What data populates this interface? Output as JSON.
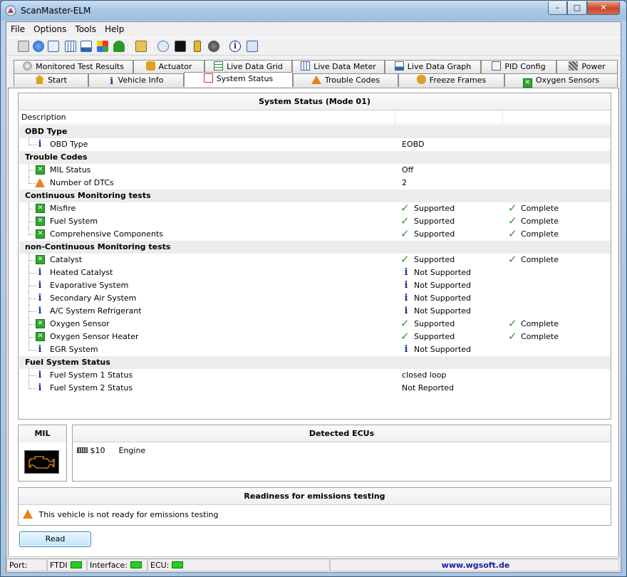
{
  "window": {
    "title": "ScanMaster-ELM",
    "controls": {
      "minimize": "–",
      "maximize": "□",
      "close": "✕"
    }
  },
  "menu": [
    "File",
    "Options",
    "Tools",
    "Help"
  ],
  "tabs_row1": [
    "Monitored Test Results",
    "Actuator",
    "Live Data Grid",
    "Live Data Meter",
    "Live Data Graph",
    "PID Config",
    "Power"
  ],
  "tabs_row2": [
    "Start",
    "Vehicle Info",
    "System Status",
    "Trouble Codes",
    "Freeze Frames",
    "Oxygen Sensors"
  ],
  "system_status": {
    "title": "System Status (Mode 01)",
    "column_description": "Description",
    "groups": [
      {
        "name": "OBD Type",
        "items": [
          {
            "label": "OBD Type",
            "icon": "info",
            "value1": "EOBD",
            "value2": ""
          }
        ]
      },
      {
        "name": "Trouble Codes",
        "items": [
          {
            "label": "MIL Status",
            "icon": "green",
            "value1": "Off",
            "value2": ""
          },
          {
            "label": "Number of DTCs",
            "icon": "warning",
            "value1": "2",
            "value2": ""
          }
        ]
      },
      {
        "name": "Continuous Monitoring tests",
        "items": [
          {
            "label": "Misfire",
            "icon": "green",
            "value1": "Supported",
            "value2": "Complete"
          },
          {
            "label": "Fuel System",
            "icon": "green",
            "value1": "Supported",
            "value2": "Complete"
          },
          {
            "label": "Comprehensive Components",
            "icon": "green",
            "value1": "Supported",
            "value2": "Complete"
          }
        ]
      },
      {
        "name": "non-Continuous Monitoring tests",
        "items": [
          {
            "label": "Catalyst",
            "icon": "green",
            "value1": "Supported",
            "value2": "Complete"
          },
          {
            "label": "Heated Catalyst",
            "icon": "info",
            "value1": "Not Supported",
            "value2": ""
          },
          {
            "label": "Evaporative System",
            "icon": "info",
            "value1": "Not Supported",
            "value2": ""
          },
          {
            "label": "Secondary Air System",
            "icon": "info",
            "value1": "Not Supported",
            "value2": ""
          },
          {
            "label": "A/C System Refrigerant",
            "icon": "info",
            "value1": "Not Supported",
            "value2": ""
          },
          {
            "label": "Oxygen Sensor",
            "icon": "green",
            "value1": "Supported",
            "value2": "Complete"
          },
          {
            "label": "Oxygen Sensor Heater",
            "icon": "green",
            "value1": "Supported",
            "value2": "Complete"
          },
          {
            "label": "EGR System",
            "icon": "info",
            "value1": "Not Supported",
            "value2": ""
          }
        ]
      },
      {
        "name": "Fuel System Status",
        "items": [
          {
            "label": "Fuel System 1 Status",
            "icon": "info",
            "value1": "closed loop",
            "value2": ""
          },
          {
            "label": "Fuel System 2 Status",
            "icon": "info",
            "value1": "Not Reported",
            "value2": ""
          }
        ]
      }
    ]
  },
  "mil": {
    "title": "MIL"
  },
  "ecus": {
    "title": "Detected ECUs",
    "items": [
      {
        "id": "$10",
        "name": "Engine"
      }
    ]
  },
  "readiness": {
    "title": "Readiness for emissions testing",
    "message": "This vehicle is not ready for emissions testing"
  },
  "read_button": "Read",
  "statusbar": {
    "port_label": "Port:",
    "port_value": "FTDI",
    "interface_label": "Interface:",
    "ecu_label": "ECU:",
    "website": "www.wgsoft.de"
  },
  "colors": {
    "accent_green": "#2fa82f",
    "info_blue": "#1c2f8f",
    "warning_orange": "#e8821a",
    "link_blue": "#1a1aa6"
  }
}
